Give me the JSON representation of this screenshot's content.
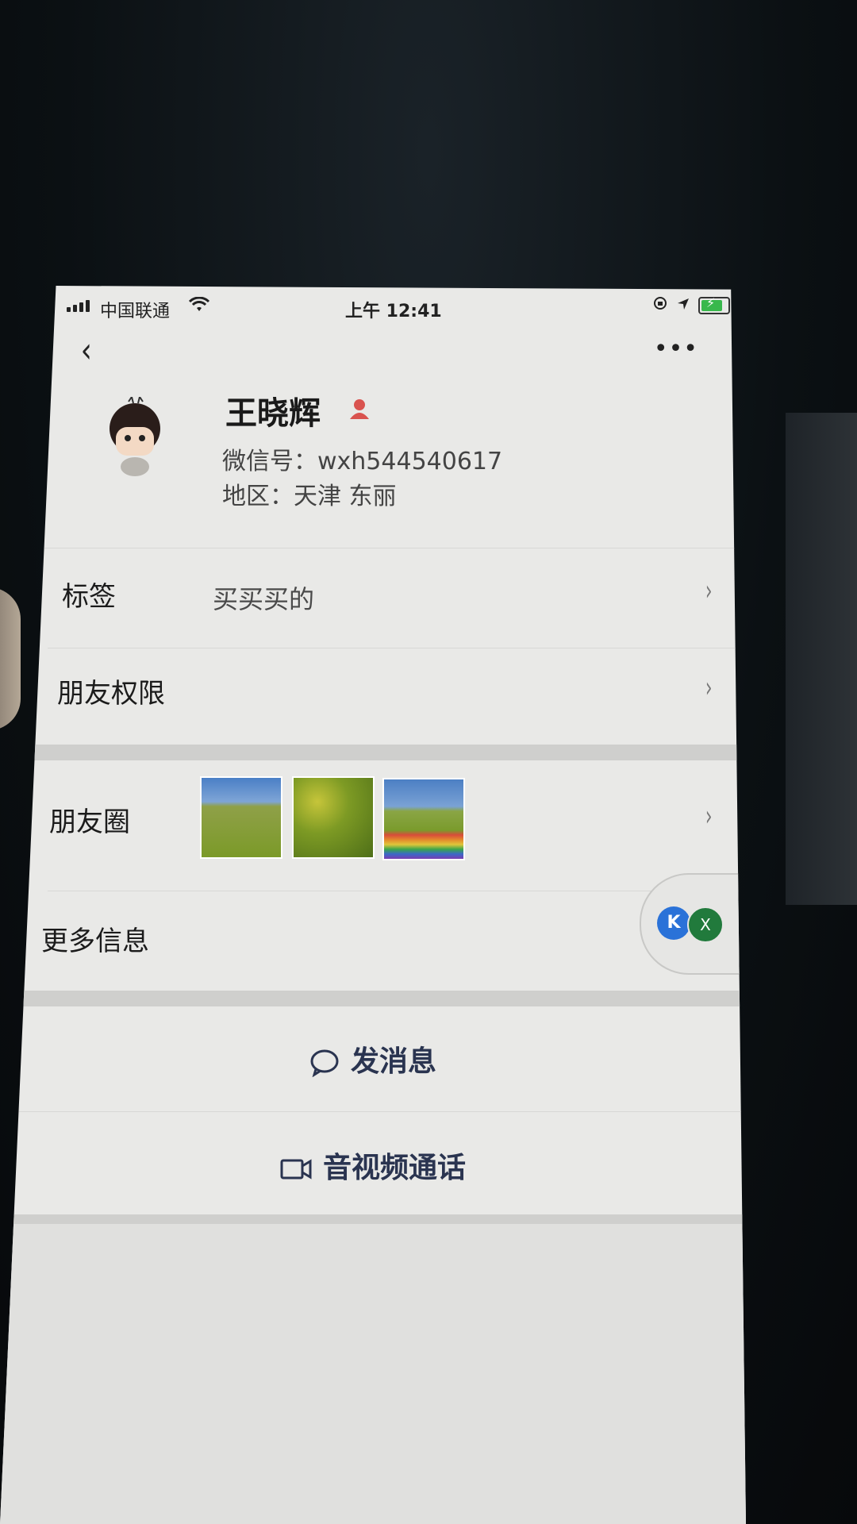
{
  "status_bar": {
    "carrier": "中国联通",
    "time": "上午 12:41",
    "battery_color": "#38b84c"
  },
  "nav": {
    "back_icon": "‹",
    "more_icon": "•••"
  },
  "profile": {
    "name": "王晓辉",
    "wechat_id": "微信号：wxh544540617",
    "region": "地区：天津 东丽",
    "gender_icon_color": "#d9534f"
  },
  "rows": {
    "tags_label": "标签",
    "tags_value": "买买买的",
    "permissions_label": "朋友权限",
    "moments_label": "朋友圈",
    "more_info_label": "更多信息"
  },
  "moments_thumbnails": [
    "field-sky",
    "flowers",
    "rainbow-path"
  ],
  "float_badge": {
    "a": "K",
    "b": "X"
  },
  "actions": {
    "message": "发消息",
    "call": "音视频通话"
  }
}
